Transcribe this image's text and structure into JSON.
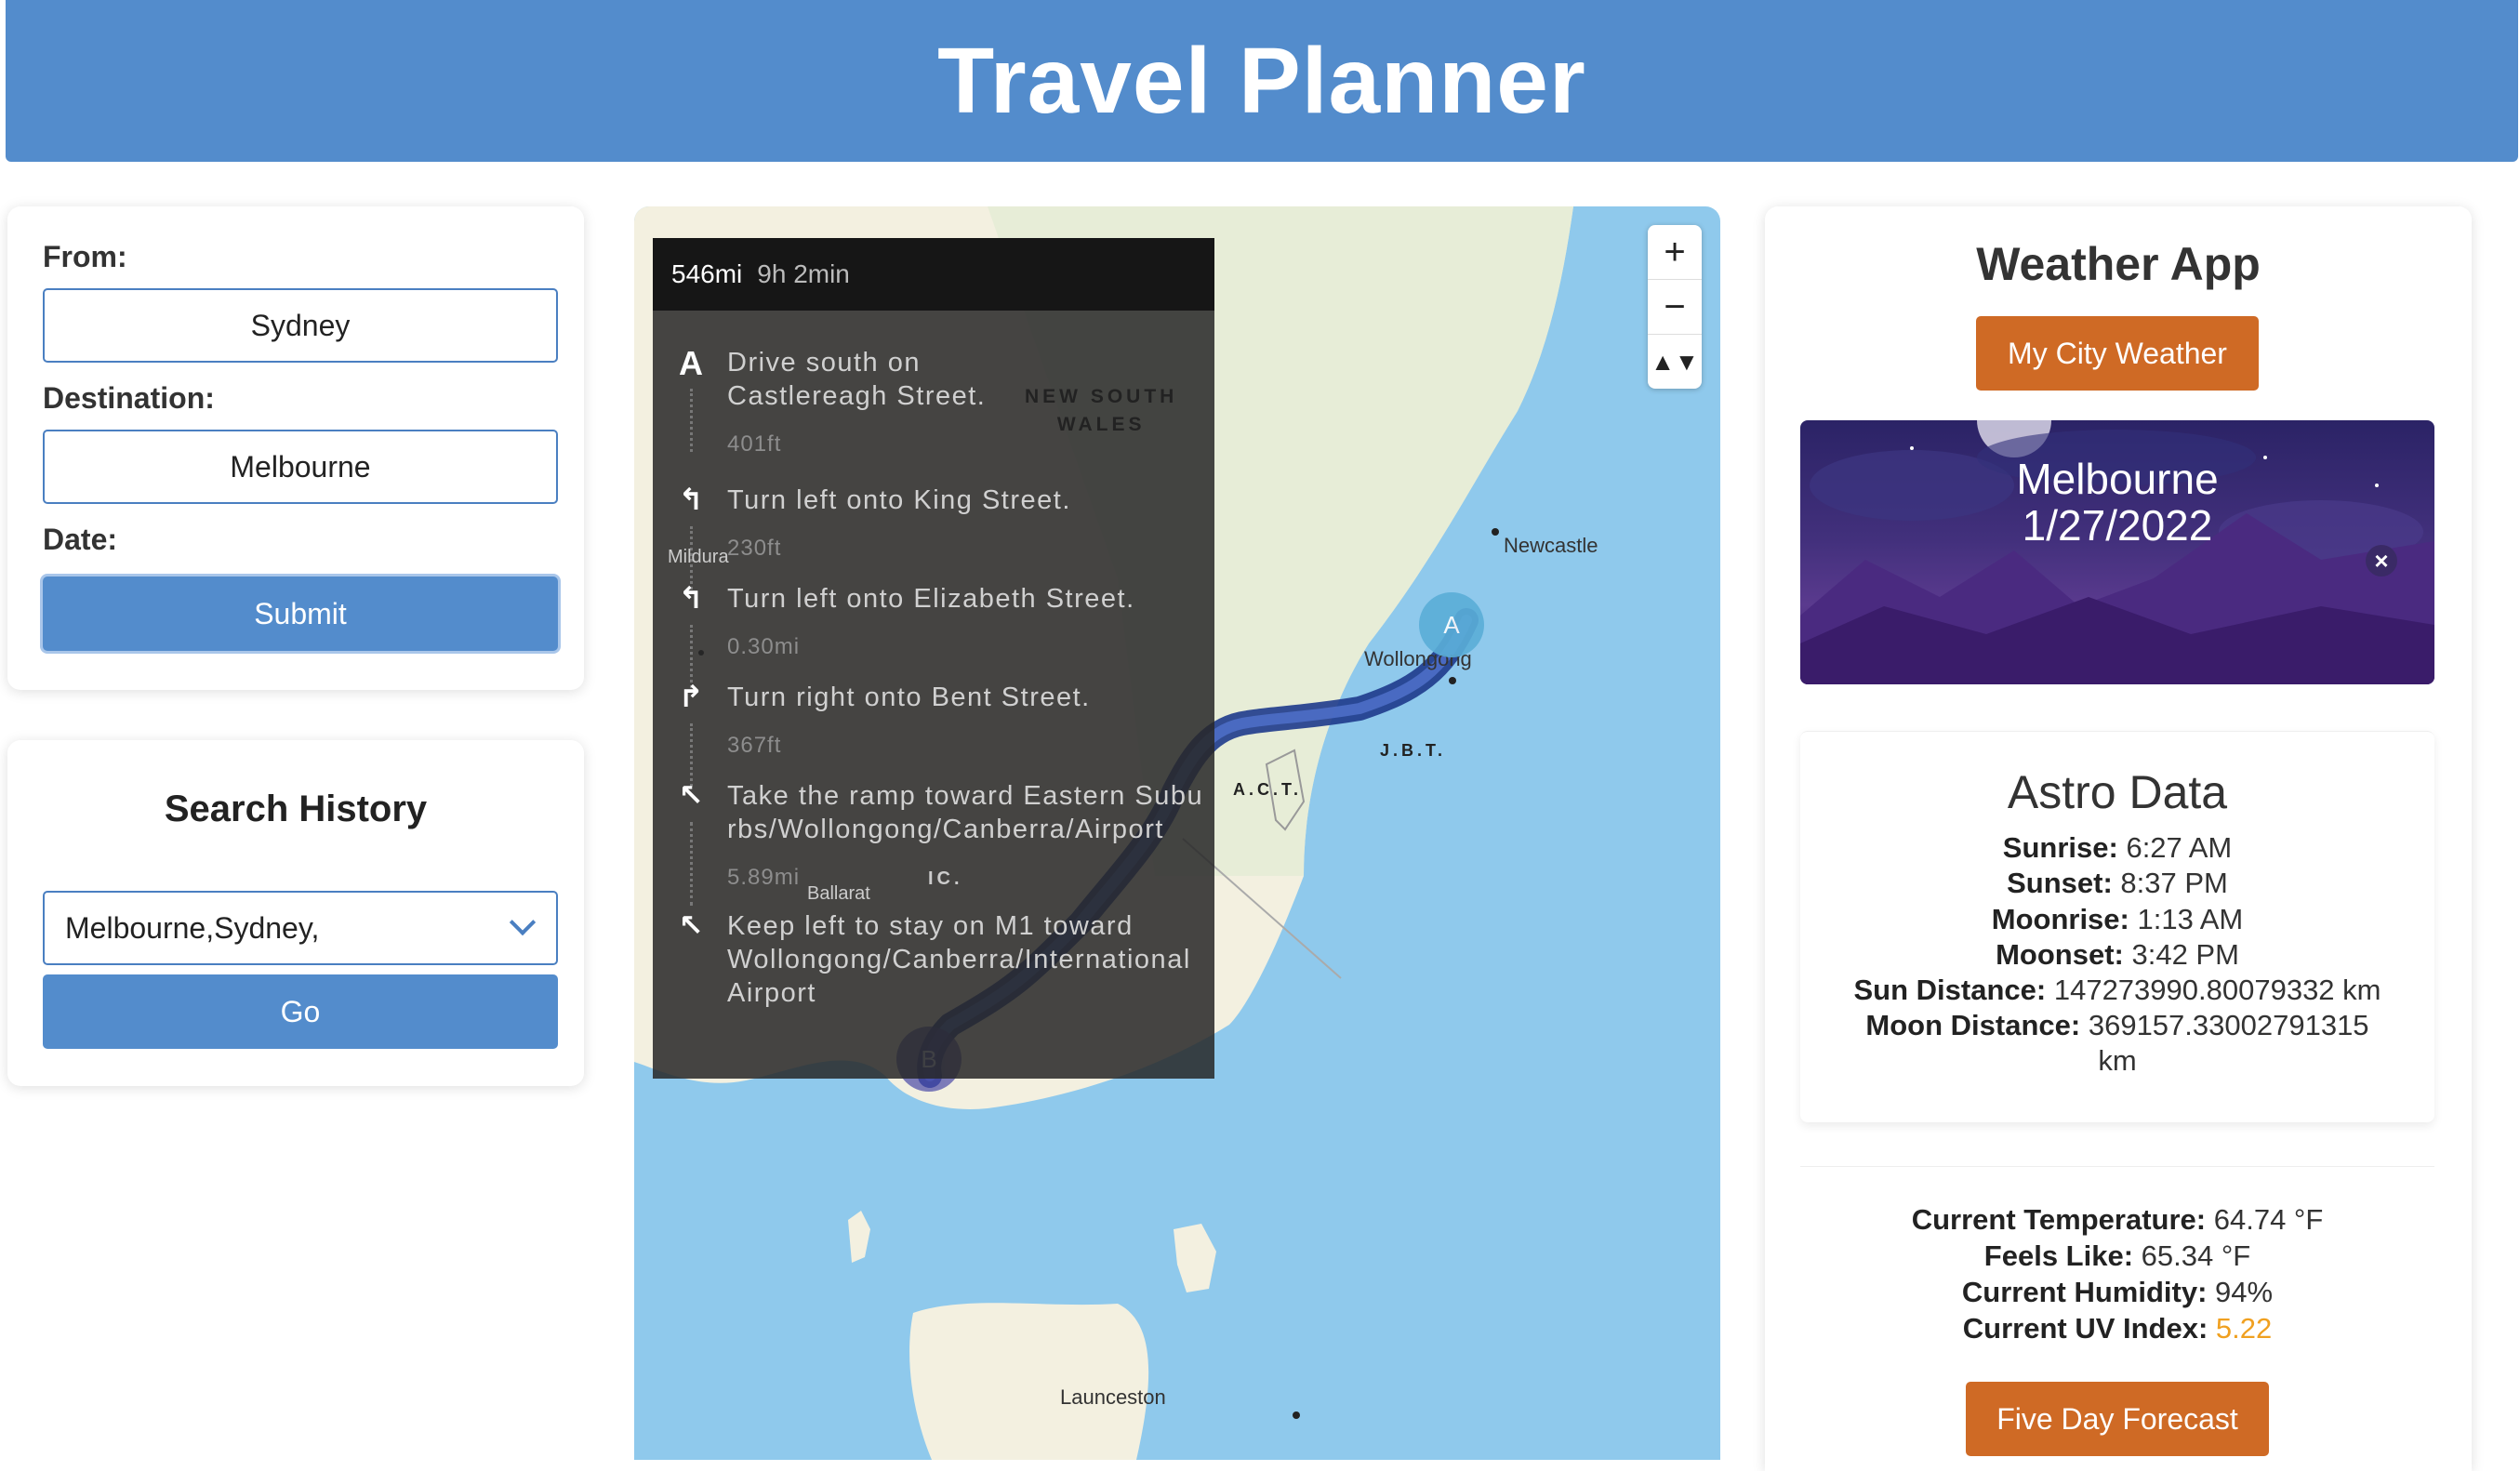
{
  "header": {
    "title": "Travel Planner"
  },
  "form": {
    "from_label": "From:",
    "from_value": "Sydney",
    "destination_label": "Destination:",
    "destination_value": "Melbourne",
    "date_label": "Date:",
    "submit_label": "Submit"
  },
  "history": {
    "title": "Search History",
    "selected": "Melbourne,Sydney,",
    "go_label": "Go"
  },
  "map": {
    "directions": {
      "distance": "546mi",
      "duration": "9h 2min",
      "steps": [
        {
          "icon": "start-marker-icon",
          "glyph": "A",
          "instruction": "Drive south on Castlereagh Street.",
          "distance": "401ft"
        },
        {
          "icon": "turn-left-icon",
          "glyph": "↰",
          "instruction": "Turn left onto King Street.",
          "distance": "230ft"
        },
        {
          "icon": "turn-left-icon",
          "glyph": "↰",
          "instruction": "Turn left onto Elizabeth Street.",
          "distance": "0.30mi"
        },
        {
          "icon": "turn-right-icon",
          "glyph": "↱",
          "instruction": "Turn right onto Bent Street.",
          "distance": "367ft"
        },
        {
          "icon": "ramp-left-icon",
          "glyph": "↖",
          "instruction": "Take the ramp toward Eastern Suburbs/Wollongong/Canberra/Airport",
          "distance": "5.89mi"
        },
        {
          "icon": "keep-left-icon",
          "glyph": "↖",
          "instruction": "Keep left to stay on M1 toward Wollongong/Canberra/International Airport",
          "distance": ""
        }
      ]
    },
    "labels": {
      "region_line1": "NEW SOUTH",
      "region_line2": "WALES",
      "newcastle": "Newcastle",
      "wollongong": "Wollongong",
      "jbt": "J.B.T.",
      "act": "A.C.T.",
      "mildura": "Mildura",
      "ballarat": "Ballarat",
      "vic": "IC.",
      "launceston": "Launceston"
    },
    "pin_a": "A",
    "pin_b": "B",
    "zoom_in": "+",
    "zoom_out": "−",
    "compass": "▲▼"
  },
  "weather": {
    "title": "Weather App",
    "my_city_label": "My City Weather",
    "city": "Melbourne",
    "date": "1/27/2022",
    "close": "×",
    "astro": {
      "title": "Astro Data",
      "sunrise_label": "Sunrise:",
      "sunrise": "6:27 AM",
      "sunset_label": "Sunset:",
      "sunset": "8:37 PM",
      "moonrise_label": "Moonrise:",
      "moonrise": "1:13 AM",
      "moonset_label": "Moonset:",
      "moonset": "3:42 PM",
      "sun_distance_label": "Sun Distance:",
      "sun_distance": "147273990.80079332 km",
      "moon_distance_label": "Moon Distance:",
      "moon_distance": "369157.33002791315",
      "moon_distance_unit": "km"
    },
    "current": {
      "temp_label": "Current Temperature:",
      "temp": "64.74 °F",
      "feels_label": "Feels Like:",
      "feels": "65.34 °F",
      "humidity_label": "Current Humidity:",
      "humidity": "94%",
      "uv_label": "Current UV Index:",
      "uv": "5.22"
    },
    "forecast_label": "Five Day Forecast"
  }
}
